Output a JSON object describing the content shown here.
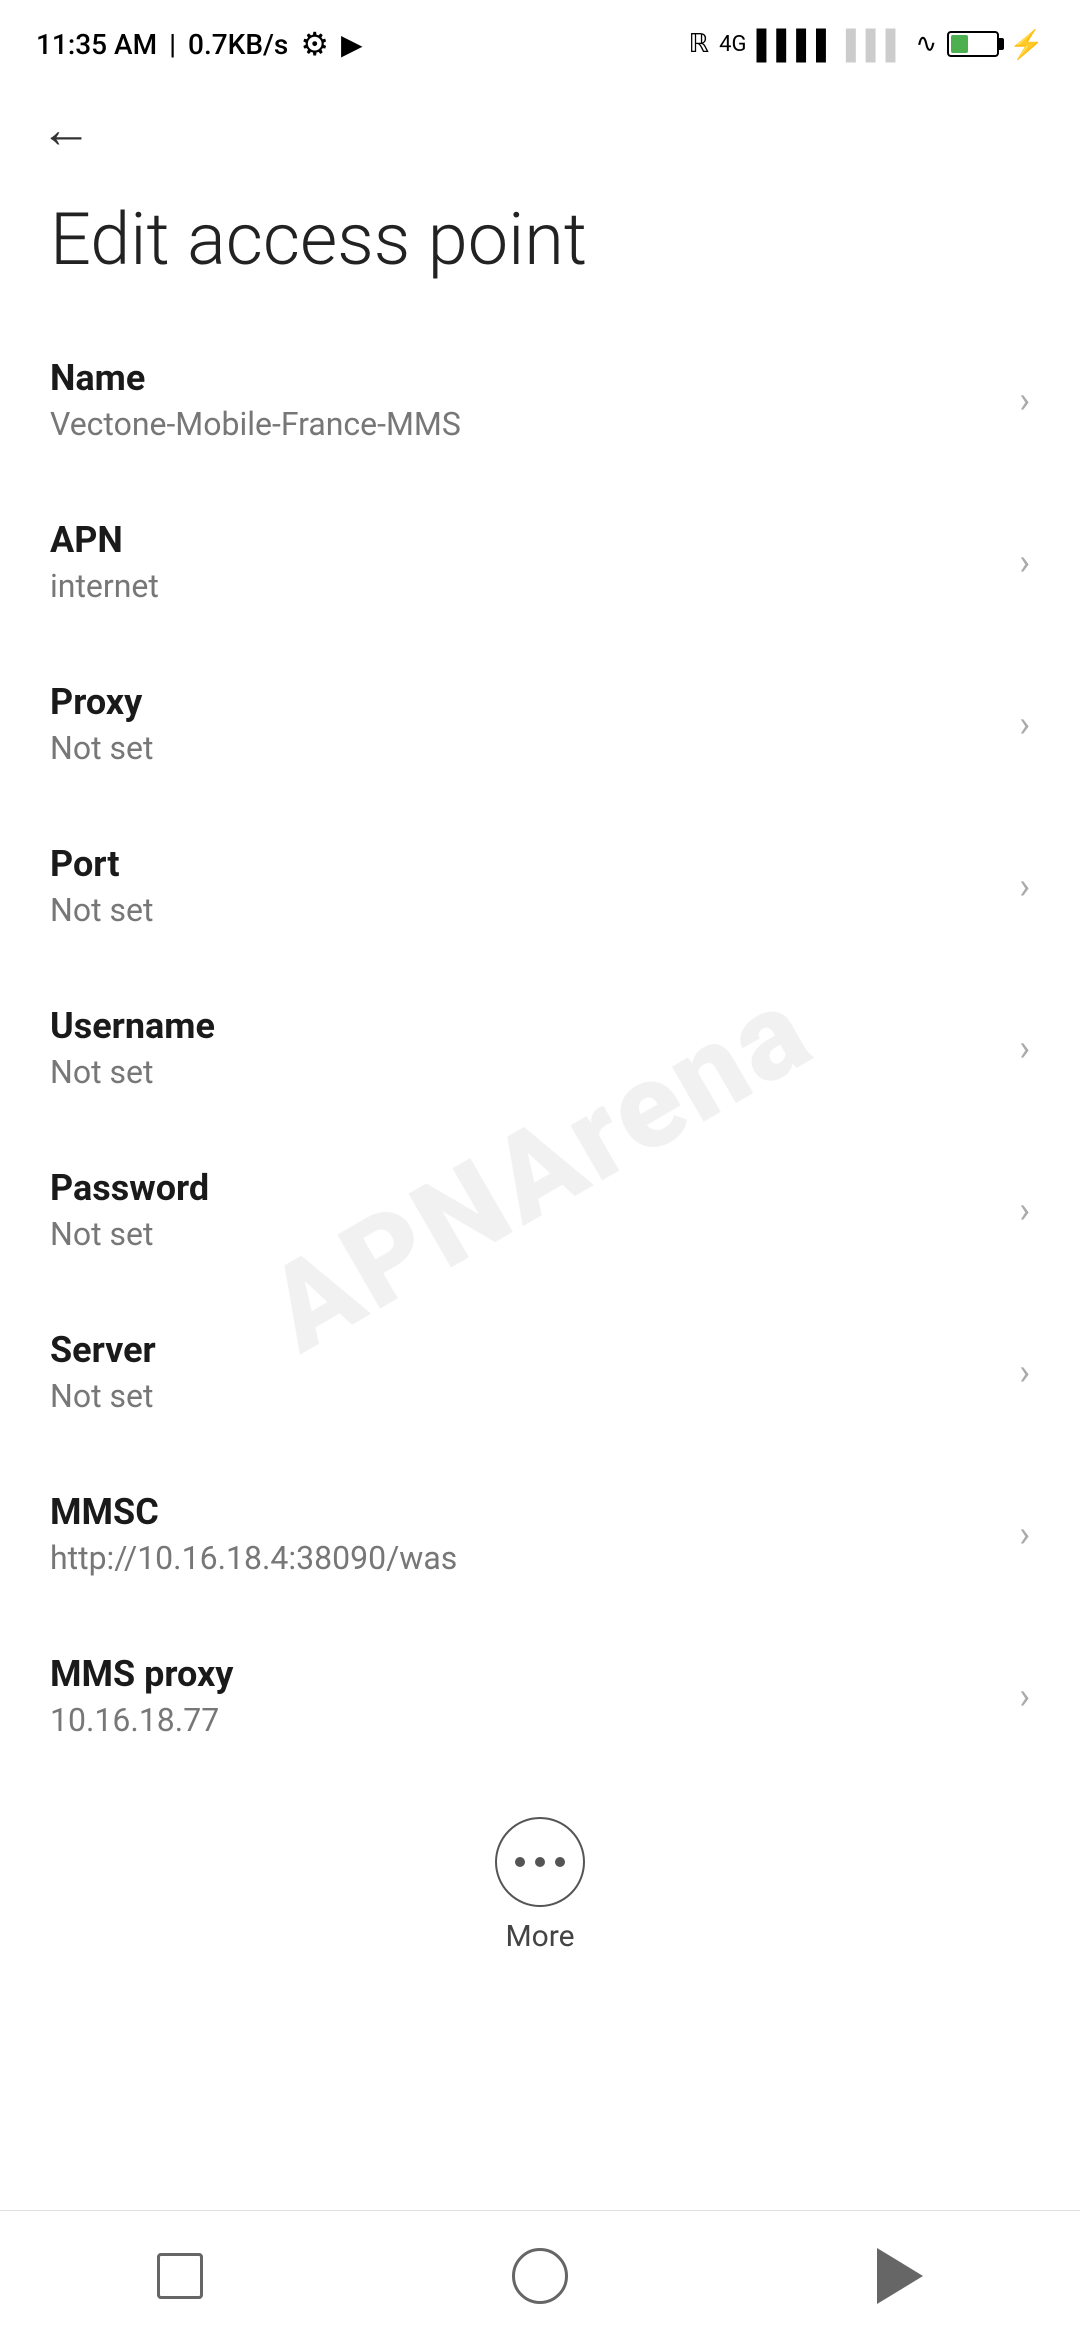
{
  "statusBar": {
    "time": "11:35 AM",
    "network": "0.7KB/s",
    "batteryPercent": "38"
  },
  "toolbar": {
    "backLabel": "←"
  },
  "pageTitle": "Edit access point",
  "settings": [
    {
      "id": "name",
      "label": "Name",
      "value": "Vectone-Mobile-France-MMS"
    },
    {
      "id": "apn",
      "label": "APN",
      "value": "internet"
    },
    {
      "id": "proxy",
      "label": "Proxy",
      "value": "Not set"
    },
    {
      "id": "port",
      "label": "Port",
      "value": "Not set"
    },
    {
      "id": "username",
      "label": "Username",
      "value": "Not set"
    },
    {
      "id": "password",
      "label": "Password",
      "value": "Not set"
    },
    {
      "id": "server",
      "label": "Server",
      "value": "Not set"
    },
    {
      "id": "mmsc",
      "label": "MMSC",
      "value": "http://10.16.18.4:38090/was"
    },
    {
      "id": "mms-proxy",
      "label": "MMS proxy",
      "value": "10.16.18.77"
    }
  ],
  "more": {
    "label": "More"
  },
  "navBar": {
    "square": "square",
    "circle": "circle",
    "triangle": "triangle"
  }
}
